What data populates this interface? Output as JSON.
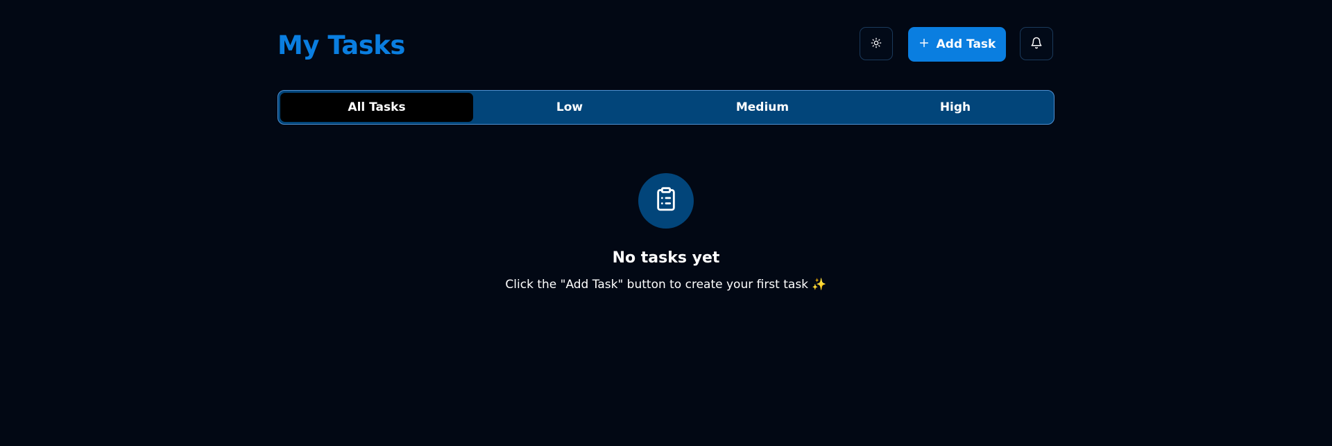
{
  "header": {
    "title": "My Tasks",
    "theme_icon": "sun-icon",
    "add_task_label": "Add Task",
    "add_task_icon": "plus-icon",
    "notifications_icon": "bell-icon"
  },
  "filters": {
    "tabs": [
      {
        "label": "All Tasks",
        "active": true
      },
      {
        "label": "Low",
        "active": false
      },
      {
        "label": "Medium",
        "active": false
      },
      {
        "label": "High",
        "active": false
      }
    ]
  },
  "empty_state": {
    "icon": "clipboard-list-icon",
    "title": "No tasks yet",
    "message": "Click the \"Add Task\" button to create your first task ✨"
  },
  "colors": {
    "background": "#020814",
    "accent": "#0a7ee0",
    "tab_bar": "#02457a",
    "tab_active": "#000000"
  }
}
